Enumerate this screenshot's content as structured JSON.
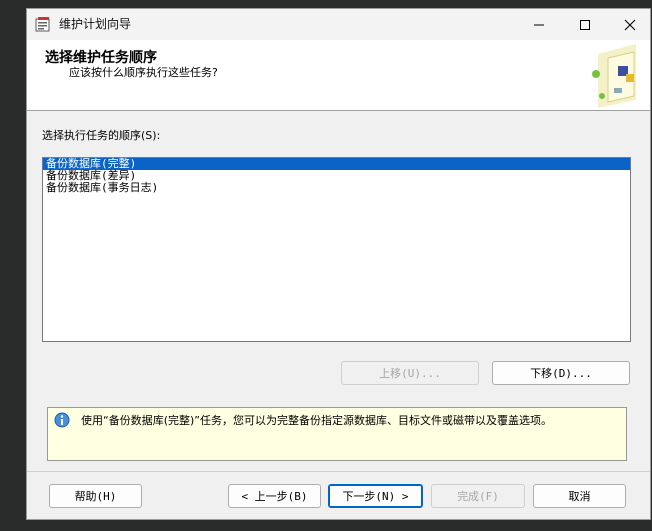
{
  "window": {
    "title": "维护计划向导"
  },
  "header": {
    "title": "选择维护任务顺序",
    "subtitle": "应该按什么顺序执行这些任务?"
  },
  "order_label": "选择执行任务的顺序(S):",
  "tasks": [
    {
      "label": "备份数据库(完整)",
      "selected": true
    },
    {
      "label": "备份数据库(差异)",
      "selected": false
    },
    {
      "label": "备份数据库(事务日志)",
      "selected": false
    }
  ],
  "move_buttons": {
    "up_label": "上移(U)...",
    "down_label": "下移(D)..."
  },
  "info_text": "使用“备份数据库(完整)”任务，您可以为完整备份指定源数据库、目标文件或磁带以及覆盖选项。",
  "footer": {
    "help_label": "帮助(H)",
    "back_label": "< 上一步(B)",
    "next_label": "下一步(N) >",
    "finish_label": "完成(F)",
    "cancel_label": "取消"
  },
  "colors": {
    "selection": "#0a64c8",
    "info_background": "#ffffe1",
    "primary_border": "#0067c0"
  }
}
